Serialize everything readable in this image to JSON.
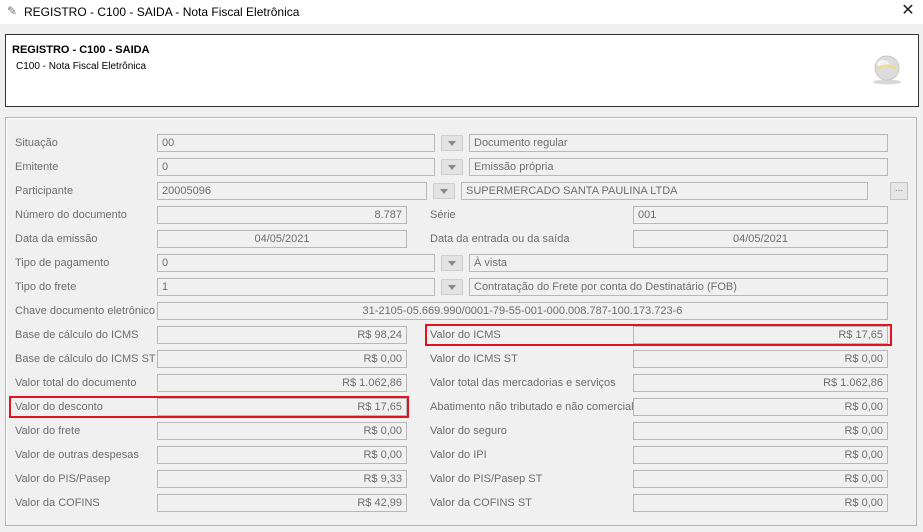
{
  "window": {
    "title": "REGISTRO - C100 - SAIDA - Nota Fiscal Eletrônica",
    "close_glyph": "✕"
  },
  "header": {
    "title": "REGISTRO - C100 - SAIDA",
    "subtitle": "C100 - Nota Fiscal Eletrônica"
  },
  "form": {
    "situacao": {
      "label": "Situação",
      "code": "00",
      "desc": "Documento regular"
    },
    "emitente": {
      "label": "Emitente",
      "code": "0",
      "desc": "Emissão própria"
    },
    "participante": {
      "label": "Participante",
      "code": "20005096",
      "desc": "SUPERMERCADO SANTA PAULINA LTDA",
      "button": "..."
    },
    "numero_documento": {
      "label": "Número do documento",
      "value": "8.787"
    },
    "serie": {
      "label": "Série",
      "value": "001"
    },
    "data_emissao": {
      "label": "Data da emissão",
      "value": "04/05/2021"
    },
    "data_entrada_saida": {
      "label": "Data da entrada ou da saída",
      "value": "04/05/2021"
    },
    "tipo_pagamento": {
      "label": "Tipo de pagamento",
      "code": "0",
      "desc": "À vista"
    },
    "tipo_frete": {
      "label": "Tipo do frete",
      "code": "1",
      "desc": "Contratação do Frete por conta do Destinatário (FOB)"
    },
    "chave": {
      "label": "Chave documento eletrônico",
      "value": "31-2105-05.669.990/0001-79-55-001-000.008.787-100.173.723-6"
    },
    "left_values": [
      {
        "label": "Base de cálculo do ICMS",
        "value": "R$ 98,24"
      },
      {
        "label": "Base de cálculo do ICMS ST",
        "value": "R$ 0,00"
      },
      {
        "label": "Valor total do documento",
        "value": "R$ 1.062,86"
      },
      {
        "label": "Valor do desconto",
        "value": "R$ 17,65"
      },
      {
        "label": "Valor do frete",
        "value": "R$ 0,00"
      },
      {
        "label": "Valor de outras despesas",
        "value": "R$ 0,00"
      },
      {
        "label": "Valor do PIS/Pasep",
        "value": "R$ 9,33"
      },
      {
        "label": "Valor da COFINS",
        "value": "R$ 42,99"
      }
    ],
    "right_values": [
      {
        "label": "Valor do ICMS",
        "value": "R$ 17,65"
      },
      {
        "label": "Valor do ICMS ST",
        "value": "R$ 0,00"
      },
      {
        "label": "Valor total das mercadorias e serviços",
        "value": "R$ 1.062,86"
      },
      {
        "label": "Abatimento não tributado e não comercial",
        "value": "R$ 0,00"
      },
      {
        "label": "Valor do seguro",
        "value": "R$ 0,00"
      },
      {
        "label": "Valor do IPI",
        "value": "R$ 0,00"
      },
      {
        "label": "Valor do PIS/Pasep ST",
        "value": "R$ 0,00"
      },
      {
        "label": "Valor da COFINS ST",
        "value": "R$ 0,00"
      }
    ]
  },
  "colors": {
    "highlight": "#e0131f",
    "field_border": "#b8b8b8",
    "text_gray": "#6d6d6d"
  },
  "icons": {
    "app": "form-icon",
    "logo": "globe-logo-icon",
    "dropdown": "chevron-down-icon"
  }
}
